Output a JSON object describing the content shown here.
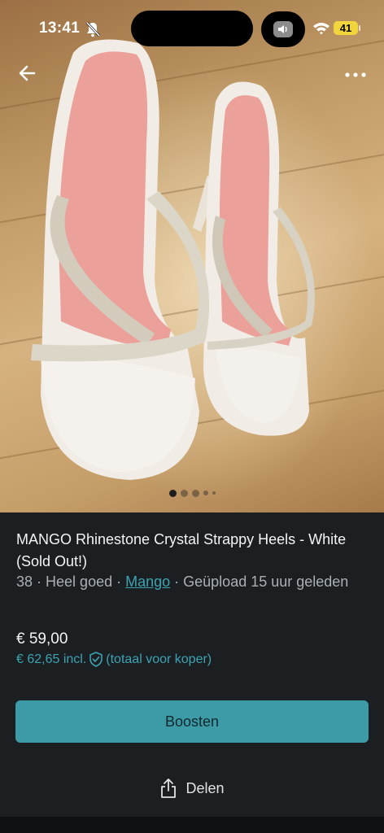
{
  "status_bar": {
    "time": "13:41",
    "battery": "41",
    "icons": [
      "bell-muted-icon",
      "speaker-icon",
      "wifi-icon",
      "battery-icon"
    ]
  },
  "photo": {
    "description_icons": [
      "back-arrow-icon",
      "more-icon"
    ],
    "page_count": 5,
    "active_page": 1
  },
  "listing": {
    "title": "MANGO Rhinestone Crystal Strappy Heels - White (Sold Out!)",
    "size": "38",
    "sep1": " · ",
    "condition": "Heel goed",
    "sep2": " · ",
    "brand": "Mango",
    "uploaded": " · Geüpload 15 uur geleden",
    "price": "€ 59,00",
    "price_incl": "€ 62,65 incl.",
    "price_incl_note": "(totaal voor koper)"
  },
  "actions": {
    "boost_label": "Boosten",
    "share_label": "Delen"
  },
  "colors": {
    "background": "#1b1f22",
    "accent": "#3d9ba8",
    "link": "#3da3b3",
    "battery": "#f2d53c"
  }
}
